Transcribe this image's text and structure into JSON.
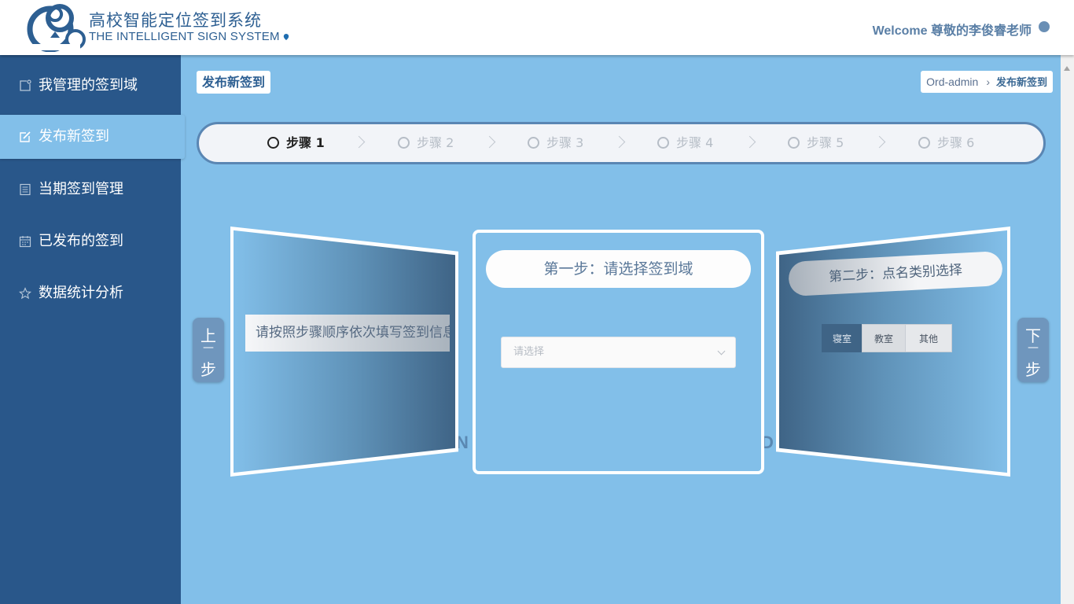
{
  "header": {
    "brand_title": "高校智能定位签到系统",
    "brand_subtitle": "THE INTELLIGENT SIGN SYSTEM",
    "welcome_text": "Welcome 尊敬的李俊睿老师"
  },
  "sidebar": {
    "items": [
      {
        "label": "我管理的签到域",
        "icon": "square-pin-icon"
      },
      {
        "label": "发布新签到",
        "icon": "edit-icon",
        "active": true
      },
      {
        "label": "当期签到管理",
        "icon": "list-icon"
      },
      {
        "label": "已发布的签到",
        "icon": "calendar-icon"
      },
      {
        "label": "数据统计分析",
        "icon": "star-icon"
      }
    ]
  },
  "page": {
    "title": "发布新签到",
    "breadcrumb": {
      "root": "Ord-admin",
      "current": "发布新签到"
    }
  },
  "steps": {
    "active_index": 0,
    "items": [
      "步骤 1",
      "步骤 2",
      "步骤 3",
      "步骤 4",
      "步骤 5",
      "步骤 6"
    ]
  },
  "carousel": {
    "prev_card": {
      "text": "请按照步骤顺序依次填写签到信息"
    },
    "current_card": {
      "heading": "第一步：请选择签到域",
      "select_placeholder": "请选择"
    },
    "next_card": {
      "heading": "第二步：点名类别选择",
      "options": [
        "寝室",
        "教室",
        "其他"
      ],
      "selected_index": 0
    },
    "prev_button": {
      "c1": "上",
      "c2": "—",
      "c3": "步"
    },
    "next_button": {
      "c1": "下",
      "c2": "—",
      "c3": "步"
    },
    "ghost_left": "N",
    "ghost_right": "D"
  },
  "colors": {
    "sidebar_bg": "#29578a",
    "content_bg": "#82bfe9",
    "brand": "#2d5f92"
  }
}
